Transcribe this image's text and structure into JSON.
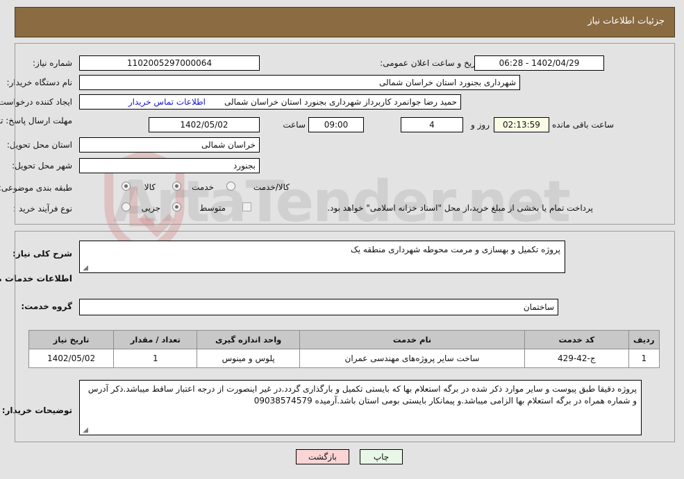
{
  "header": {
    "title": "جزئیات اطلاعات نیاز"
  },
  "colors": {
    "header_bg": "#8a6b42",
    "header_text": "#ffffff",
    "page_bg": "#e3e3e3",
    "link": "#1414cf",
    "timer_bg": "#fbfbe6",
    "print_btn_bg": "#e9f7e9",
    "back_btn_bg": "#fbd5d5",
    "table_header_bg": "#c8c8c8"
  },
  "watermark": {
    "text": "ArtaTender.net",
    "shield_icon": "shield-icon"
  },
  "top_form": {
    "need_number": {
      "label": "شماره نیاز:",
      "value": "1102005297000064"
    },
    "announce_datetime": {
      "label": "تاریخ و ساعت اعلان عمومی:",
      "value": "1402/04/29 - 06:28"
    },
    "buyer_org": {
      "label": "نام دستگاه خریدار:",
      "value": "شهرداری بجنورد استان خراسان شمالی"
    },
    "requester": {
      "label": "ایجاد کننده درخواست:",
      "value": "حمید رضا جوانمرد کاربرداز شهرداری بجنورد استان خراسان شمالی"
    },
    "buyer_contact_link": "اطلاعات تماس خریدار",
    "deadline": {
      "label": "مهلت ارسال پاسخ: تا تاریخ:",
      "date": "1402/05/02",
      "time_label": "ساعت",
      "time": "09:00",
      "days": "4",
      "days_label": "روز و",
      "remaining": "02:13:59",
      "remaining_label": "ساعت باقی مانده"
    },
    "delivery_province": {
      "label": "استان محل تحویل:",
      "value": "خراسان شمالی"
    },
    "delivery_city": {
      "label": "شهر محل تحویل:",
      "value": "بجنورد"
    },
    "category": {
      "label": "طبقه بندی موضوعی:",
      "options": [
        {
          "label": "کالا",
          "selected": false
        },
        {
          "label": "خدمت",
          "selected": true
        },
        {
          "label": "کالا/خدمت",
          "selected": false
        }
      ]
    },
    "process_type": {
      "label": "نوع فرآیند خرید :",
      "options": [
        {
          "label": "جزیی",
          "selected": false
        },
        {
          "label": "متوسط",
          "selected": true
        }
      ],
      "treasury_checkbox": {
        "label": "پرداخت تمام یا بخشی از مبلغ خرید،از محل \"اسناد خزانه اسلامی\" خواهد بود.",
        "checked": false
      }
    }
  },
  "bottom_form": {
    "general_description": {
      "label": "شرح کلی نیاز:",
      "value": "پروژه تکمیل و بهسازی و مرمت محوطه شهرداری منطقه یک"
    },
    "services_heading": "اطلاعات خدمات مورد نیاز",
    "service_group": {
      "label": "گروه خدمت:",
      "value": "ساختمان"
    },
    "table": {
      "headers": [
        "ردیف",
        "کد خدمت",
        "نام خدمت",
        "واحد اندازه گیری",
        "تعداد / مقدار",
        "تاریخ نیاز"
      ],
      "rows": [
        {
          "row": "1",
          "service_code": "ج-42-429",
          "service_name": "ساخت سایر پروژه‌های مهندسی عمران",
          "unit": "پلوس و مینوس",
          "quantity": "1",
          "need_date": "1402/05/02"
        }
      ]
    },
    "buyer_notes": {
      "label": "توضیحات خریدار:",
      "value": "پروژه دقیقا طبق پیوست و سایر موارد ذکر شده در برگه استعلام بها که بایستی تکمیل و بارگذاری گردد.در غیر اینصورت از درجه اعتبار ساقط میباشد.ذکر آدرس و شماره همراه در برگه استعلام بها الزامی میباشد.و پیمانکار بایستی بومی استان باشد.آرمیده 09038574579"
    }
  },
  "footer": {
    "print_label": "چاپ",
    "back_label": "بازگشت"
  }
}
